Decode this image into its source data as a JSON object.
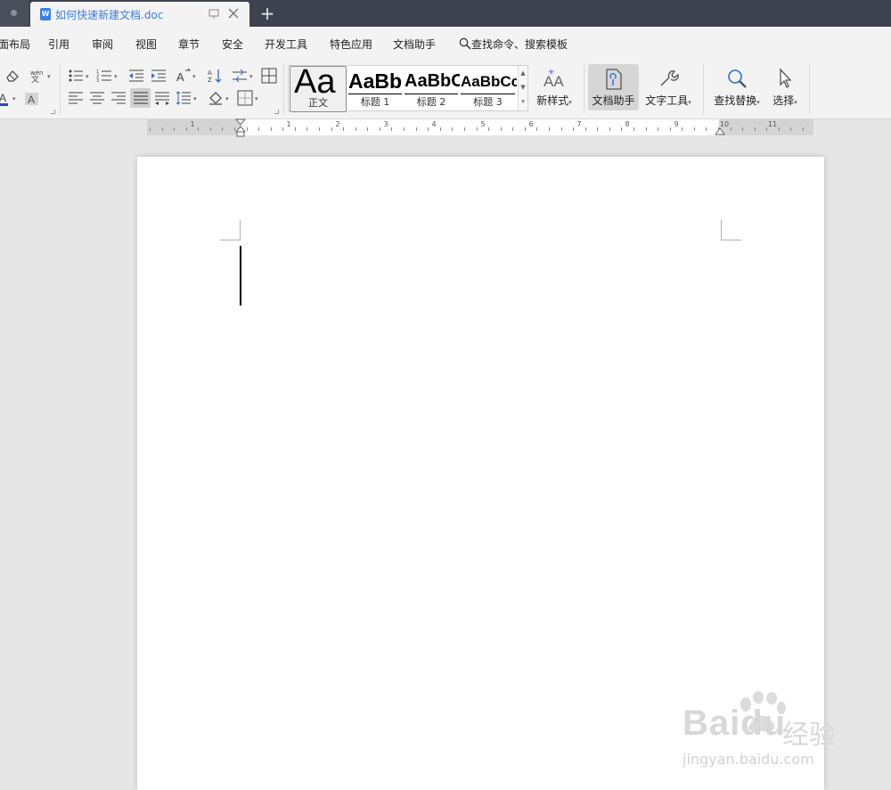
{
  "tab": {
    "title": "如何快速新建文档.doc",
    "icon_letter": "W",
    "new_tab_symbol": "+"
  },
  "menu": {
    "items": [
      "面布局",
      "引用",
      "审阅",
      "视图",
      "章节",
      "安全",
      "开发工具",
      "特色应用",
      "文档助手"
    ],
    "search_label": "查找命令、搜索模板"
  },
  "styles": {
    "items": [
      {
        "preview": "Aa",
        "label": "正文",
        "selected": true
      },
      {
        "preview": "AaBb",
        "label": "标题 1"
      },
      {
        "preview": "AaBbC",
        "label": "标题 2"
      },
      {
        "preview": "AaBbCc",
        "label": "标题 3"
      }
    ]
  },
  "tools": {
    "new_style": "新样式",
    "doc_assistant": "文档助手",
    "text_tools": "文字工具",
    "find_replace": "查找替换",
    "select": "选择"
  },
  "ruler": {
    "left_numbers": [
      "1"
    ],
    "numbers": [
      "1",
      "2",
      "3",
      "4",
      "5",
      "6",
      "7",
      "8",
      "9",
      "10",
      "11"
    ]
  },
  "watermark": {
    "logo": "Baidu",
    "cn": "经验",
    "url": "jingyan.baidu.com"
  },
  "colors": {
    "tabbar": "#3f4350",
    "accent": "#3b7ee8",
    "toolbar": "#f3f3f3"
  }
}
